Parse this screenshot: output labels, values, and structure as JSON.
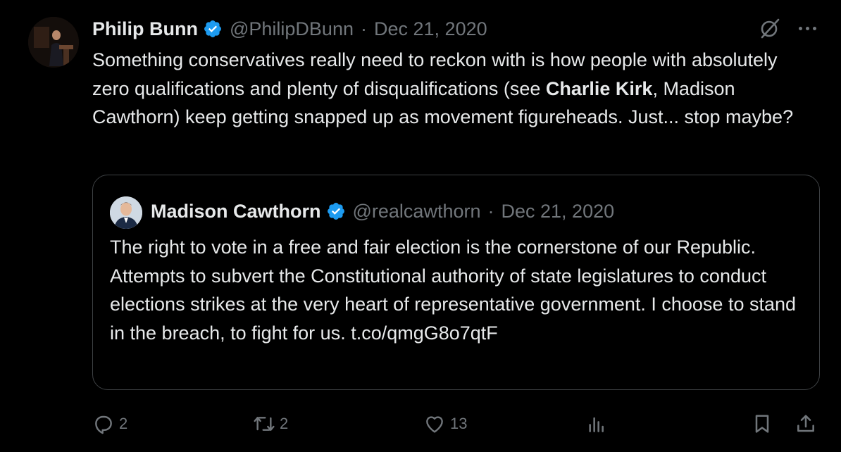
{
  "tweet": {
    "author_name": "Philip Bunn",
    "author_handle": "@PhilipDBunn",
    "separator": "·",
    "date": "Dec 21, 2020",
    "text_1": "Something conservatives really need to reckon with is how people with absolutely zero qualifications and plenty of disqualifications (see ",
    "text_bold": "Charlie Kirk",
    "text_2": ", Madison Cawthorn) keep getting snapped up as movement figureheads. Just... stop maybe?"
  },
  "quoted": {
    "author_name": "Madison Cawthorn",
    "author_handle": "@realcawthorn",
    "separator": "·",
    "date": "Dec 21, 2020",
    "text": "The right to vote in a free and fair election is the cornerstone of our Republic. Attempts to subvert the Constitutional authority of state legislatures to conduct elections strikes at the very heart of representative government. I choose to stand in the breach, to fight for us. t.co/qmgG8o7qtF"
  },
  "actions": {
    "reply_count": "2",
    "retweet_count": "2",
    "like_count": "13"
  },
  "icons": {
    "verified": "verified-badge-icon",
    "grok": "grok-icon",
    "more": "more-icon",
    "reply": "reply-icon",
    "retweet": "retweet-icon",
    "like": "heart-icon",
    "views": "views-icon",
    "bookmark": "bookmark-icon",
    "share": "share-icon"
  },
  "colors": {
    "background": "#000000",
    "text": "#e7e9ea",
    "muted": "#71767b",
    "verified": "#1d9bf0",
    "border": "#3e4144"
  }
}
